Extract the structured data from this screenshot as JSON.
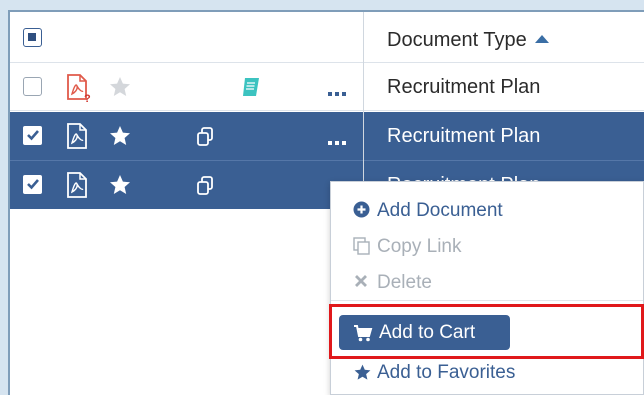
{
  "table": {
    "header": {
      "column_label": "Document Type",
      "sort": "ascending"
    },
    "rows": [
      {
        "type": "Recruitment Plan",
        "selected": false,
        "pdf_state": "missing",
        "favorite": false,
        "has_book": true,
        "has_link": false
      },
      {
        "type": "Recruitment Plan",
        "selected": true,
        "pdf_state": "present",
        "favorite": true,
        "has_book": false,
        "has_link": true
      },
      {
        "type": "Recruitment Plan",
        "selected": true,
        "pdf_state": "present",
        "favorite": true,
        "has_book": false,
        "has_link": true
      }
    ],
    "more_glyph": "•••"
  },
  "context_menu": {
    "items": [
      {
        "label": "Add Document",
        "icon": "plus-circle-icon",
        "enabled": true
      },
      {
        "label": "Copy Link",
        "icon": "copy-icon",
        "enabled": false
      },
      {
        "label": "Delete",
        "icon": "x-icon",
        "enabled": false
      },
      {
        "label": "Add to Cart",
        "icon": "cart-icon",
        "enabled": true,
        "highlighted": true
      },
      {
        "label": "Add to Favorites",
        "icon": "star-icon",
        "enabled": true
      }
    ]
  },
  "colors": {
    "selected_row": "#3a5f93",
    "accent": "#3a6ea5",
    "highlight_outline": "#e0181b",
    "pdf_missing": "#e05a4a",
    "book_icon": "#3cc3c0"
  }
}
